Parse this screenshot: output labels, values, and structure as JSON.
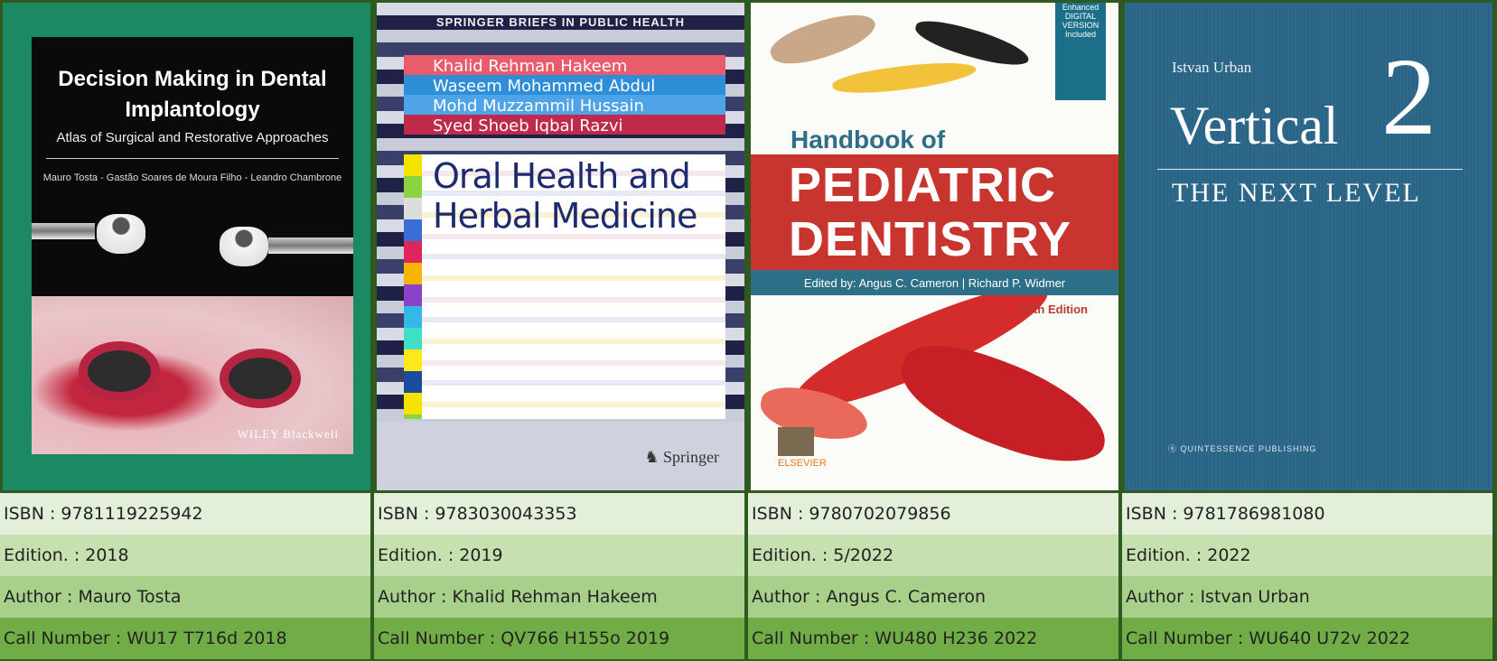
{
  "books": [
    {
      "cover": {
        "title_line1": "Decision Making in Dental",
        "title_line2": "Implantology",
        "subtitle": "Atlas of Surgical and Restorative Approaches",
        "authors": "Mauro Tosta - Gastão Soares de Moura Filho - Leandro Chambrone",
        "publisher": "WILEY Blackwell"
      },
      "isbn": "ISBN : 9781119225942",
      "edition": "Edition. : 2018",
      "author": "Author : Mauro Tosta",
      "call_number": "Call Number : WU17 T716d 2018"
    },
    {
      "cover": {
        "series": "SPRINGER BRIEFS IN PUBLIC HEALTH",
        "authors": [
          "Khalid Rehman Hakeem",
          "Waseem Mohammed Abdul",
          "Mohd Muzzammil Hussain",
          "Syed Shoeb Iqbal Razvi"
        ],
        "title_line1": "Oral Health and",
        "title_line2": "Herbal Medicine",
        "publisher": "Springer"
      },
      "isbn": "ISBN : 9783030043353",
      "edition": "Edition. :  2019",
      "author": "Author :  Khalid Rehman Hakeem",
      "call_number": "Call Number : QV766 H155o 2019"
    },
    {
      "cover": {
        "badge": "Enhanced DIGITAL VERSION Included",
        "handbook": "Handbook of",
        "title_line1": "PEDIATRIC",
        "title_line2": "DENTISTRY",
        "editors": "Edited by: Angus C. Cameron | Richard P. Widmer",
        "edition": "Fifth Edition",
        "publisher": "ELSEVIER"
      },
      "isbn": "ISBN : 9780702079856",
      "edition": "Edition. :  5/2022",
      "author": "Author : Angus C. Cameron",
      "call_number": "Call Number : WU480 H236 2022"
    },
    {
      "cover": {
        "author": "Istvan Urban",
        "title_word": "Vertical",
        "title_number": "2",
        "subtitle": "THE NEXT LEVEL",
        "publisher": "QUINTESSENCE PUBLISHING"
      },
      "isbn": "ISBN : 9781786981080",
      "edition": "Edition. :  2022",
      "author": "Author :  Istvan Urban",
      "call_number": "Call Number : WU640 U72v 2022"
    }
  ]
}
